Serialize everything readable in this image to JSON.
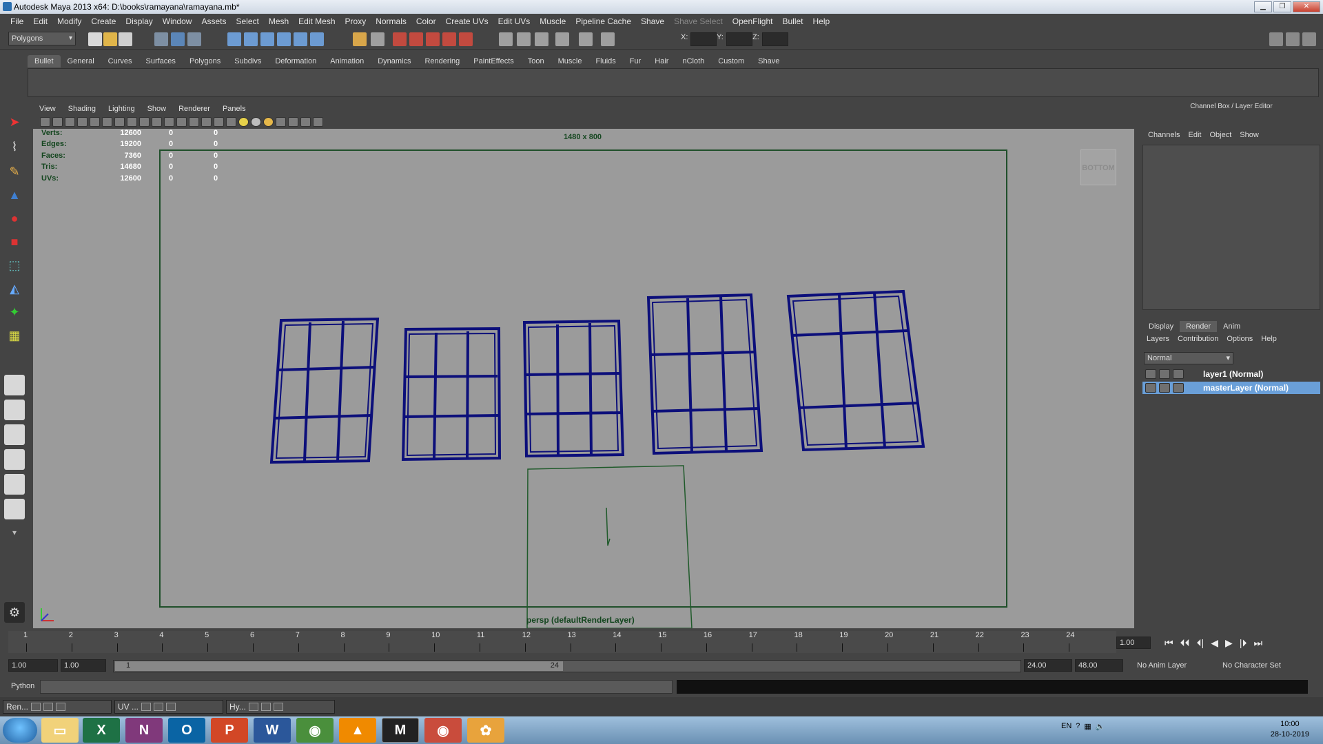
{
  "window": {
    "title": "Autodesk Maya 2013 x64: D:\\books\\ramayana\\ramayana.mb*"
  },
  "menubar": [
    "File",
    "Edit",
    "Modify",
    "Create",
    "Display",
    "Window",
    "Assets",
    "Select",
    "Mesh",
    "Edit Mesh",
    "Proxy",
    "Normals",
    "Color",
    "Create UVs",
    "Edit UVs",
    "Muscle",
    "Pipeline Cache",
    "Shave",
    "Shave Select",
    "OpenFlight",
    "Bullet",
    "Help"
  ],
  "toolbar": {
    "mode": "Polygons",
    "x_label": "X:",
    "y_label": "Y:",
    "z_label": "Z:"
  },
  "shelf_tabs": [
    "Bullet",
    "General",
    "Curves",
    "Surfaces",
    "Polygons",
    "Subdivs",
    "Deformation",
    "Animation",
    "Dynamics",
    "Rendering",
    "PaintEffects",
    "Toon",
    "Muscle",
    "Fluids",
    "Fur",
    "Hair",
    "nCloth",
    "Custom",
    "Shave"
  ],
  "shelf_active": "Bullet",
  "panel_menu": [
    "View",
    "Shading",
    "Lighting",
    "Show",
    "Renderer",
    "Panels"
  ],
  "hud": {
    "rows": [
      {
        "label": "Verts:",
        "value": "12600",
        "a": "0",
        "b": "0"
      },
      {
        "label": "Edges:",
        "value": "19200",
        "a": "0",
        "b": "0"
      },
      {
        "label": "Faces:",
        "value": "7360",
        "a": "0",
        "b": "0"
      },
      {
        "label": "Tris:",
        "value": "14680",
        "a": "0",
        "b": "0"
      },
      {
        "label": "UVs:",
        "value": "12600",
        "a": "0",
        "b": "0"
      }
    ],
    "resolution": "1480 x 800",
    "camera": "persp (defaultRenderLayer)",
    "viewcube": "BOTTOM"
  },
  "channel_box": {
    "title": "Channel Box / Layer Editor",
    "menu": [
      "Channels",
      "Edit",
      "Object",
      "Show"
    ],
    "layer_tabs": [
      "Display",
      "Render",
      "Anim"
    ],
    "layer_tab_active": "Render",
    "layer_menu": [
      "Layers",
      "Contribution",
      "Options",
      "Help"
    ],
    "blend_mode": "Normal",
    "layers": [
      {
        "name": "layer1 (Normal)",
        "selected": false
      },
      {
        "name": "masterLayer (Normal)",
        "selected": true
      }
    ]
  },
  "timeline": {
    "ticks": [
      "1",
      "2",
      "3",
      "4",
      "5",
      "6",
      "7",
      "8",
      "9",
      "10",
      "11",
      "12",
      "13",
      "14",
      "15",
      "16",
      "17",
      "18",
      "19",
      "20",
      "21",
      "22",
      "23",
      "24"
    ],
    "current_frame": "1.00"
  },
  "range": {
    "start": "1.00",
    "playback_start": "1.00",
    "slider_start": "1",
    "slider_end": "24",
    "playback_end": "24.00",
    "end": "48.00",
    "anim_layer": "No Anim Layer",
    "character_set": "No Character Set"
  },
  "command_line": {
    "label": "Python"
  },
  "minimized_windows": [
    "Ren...",
    "UV ...",
    "Hy..."
  ],
  "taskbar": {
    "apps": [
      "explorer",
      "excel",
      "onenote",
      "outlook",
      "powerpoint",
      "word",
      "chrome",
      "vlc",
      "maya",
      "chrome",
      "paint"
    ],
    "language": "EN",
    "time": "10:00",
    "date": "28-10-2019"
  },
  "colors": {
    "wireframe": "#0c0f7a",
    "selection": "#6a9fd8",
    "hud_green": "#14461f"
  }
}
